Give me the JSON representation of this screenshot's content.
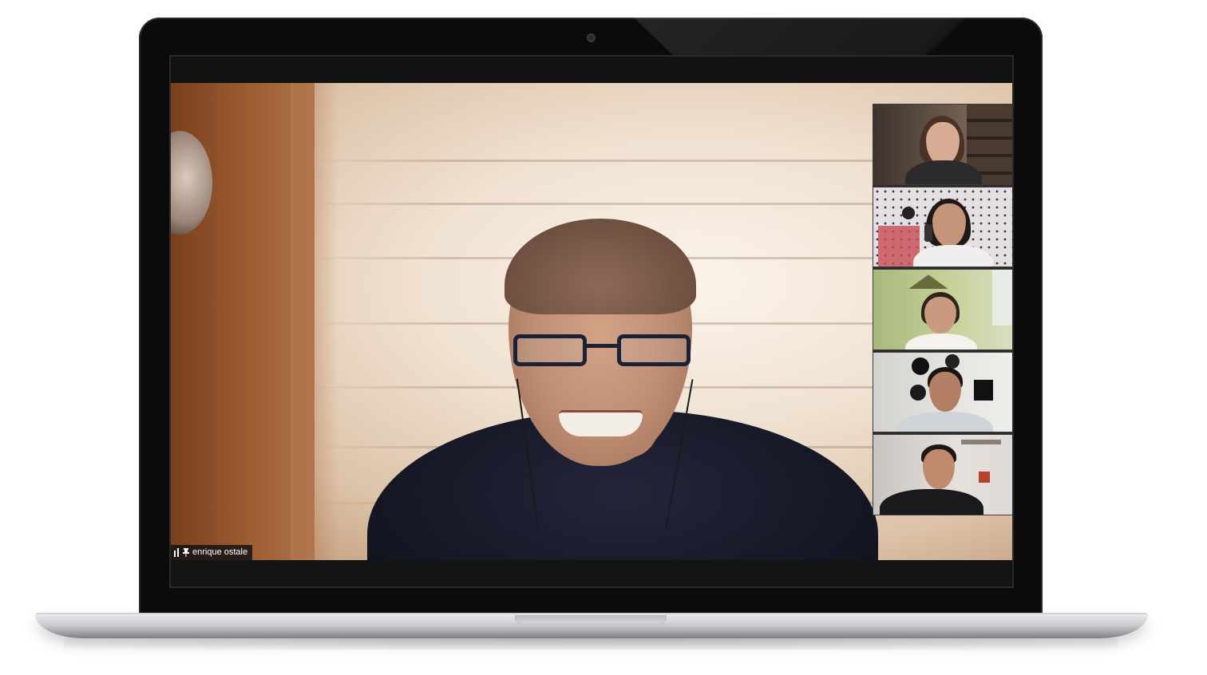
{
  "meeting": {
    "active_speaker": {
      "name": "enrique ostale",
      "audio_icon": "audio-level-icon",
      "pin_icon": "pin-icon"
    },
    "thumbnails": [
      {
        "id": "participant-1",
        "bg": "#5b4a3e"
      },
      {
        "id": "participant-2",
        "bg": "#dcd4d8"
      },
      {
        "id": "participant-3",
        "bg": "#b6c28a"
      },
      {
        "id": "participant-4",
        "bg": "#dad9d6"
      },
      {
        "id": "participant-5",
        "bg": "#d7d2cd"
      }
    ]
  },
  "colors": {
    "bezel": "#0c0b0b",
    "screen_bar": "#141414",
    "name_tag_bg": "#141414",
    "name_tag_text": "#ffffff",
    "laptop_silver": "#c9cacd"
  }
}
